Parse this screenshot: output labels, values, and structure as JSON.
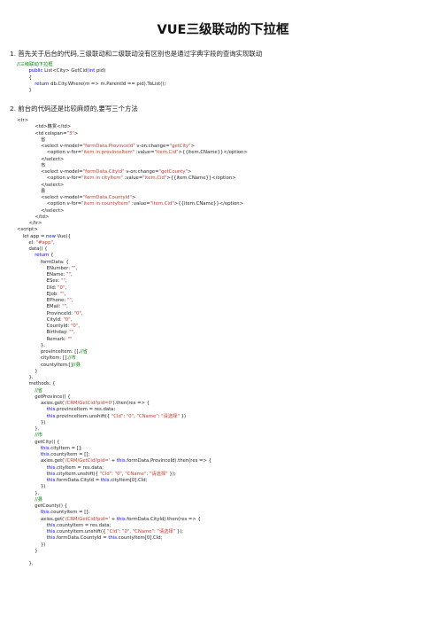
{
  "title": "VUE三级联动的下拉框",
  "section1": {
    "heading": "1. 首先关于后台的代码,三级联动和二级联动没有区别也是通过字典字段的查询实现联动",
    "code": [
      [
        {
          "t": "//三级联动下拉框",
          "c": "cm"
        }
      ],
      [
        {
          "t": "        "
        },
        {
          "t": "public",
          "c": "kw"
        },
        {
          "t": " List<City> GetCid("
        },
        {
          "t": "int",
          "c": "kw"
        },
        {
          "t": " pid)"
        }
      ],
      [
        {
          "t": "        {"
        }
      ],
      [
        {
          "t": "            "
        },
        {
          "t": "return",
          "c": "kw"
        },
        {
          "t": " db.City.Where(m => m.ParentId == pid).ToList();"
        }
      ],
      [
        {
          "t": "        }"
        }
      ]
    ]
  },
  "section2": {
    "heading": "2. 前台的代码还是比较麻烦的,要写三个方法",
    "code": [
      [
        {
          "t": "<tr>"
        }
      ],
      [
        {
          "t": "            <td>籍贯</td>"
        }
      ],
      [
        {
          "t": "            <td colspan="
        },
        {
          "t": "\"3\"",
          "c": "str"
        },
        {
          "t": ">"
        }
      ],
      [
        {
          "t": "                省"
        }
      ],
      [
        {
          "t": "                <select v-model="
        },
        {
          "t": "\"formData.ProvinceId\"",
          "c": "str"
        },
        {
          "t": " v-on:change="
        },
        {
          "t": "\"getCity\"",
          "c": "str"
        },
        {
          "t": ">"
        }
      ],
      [
        {
          "t": "                    <option v-for="
        },
        {
          "t": "\"item in provinceItem\"",
          "c": "str"
        },
        {
          "t": " :value="
        },
        {
          "t": "\"item.Cid\"",
          "c": "str"
        },
        {
          "t": ">{{item.CName}}</option>"
        }
      ],
      [
        {
          "t": "                </select>"
        }
      ],
      [
        {
          "t": "                市"
        }
      ],
      [
        {
          "t": "                <select v-model="
        },
        {
          "t": "\"formData.CityId\"",
          "c": "str"
        },
        {
          "t": " v-on:change="
        },
        {
          "t": "\"getCounty\"",
          "c": "str"
        },
        {
          "t": ">"
        }
      ],
      [
        {
          "t": "                    <option v-for="
        },
        {
          "t": "\"item in cityItem\"",
          "c": "str"
        },
        {
          "t": " :value="
        },
        {
          "t": "\"item.Cid\"",
          "c": "str"
        },
        {
          "t": ">{{item.CName}}</option>"
        }
      ],
      [
        {
          "t": "                </select>"
        }
      ],
      [
        {
          "t": "                县"
        }
      ],
      [
        {
          "t": "                <select v-model="
        },
        {
          "t": "\"formData.CountyId\"",
          "c": "str"
        },
        {
          "t": ">"
        }
      ],
      [
        {
          "t": "                    <option v-for="
        },
        {
          "t": "\"item in countyItem\"",
          "c": "str"
        },
        {
          "t": " :value="
        },
        {
          "t": "\"item.Cid\"",
          "c": "str"
        },
        {
          "t": ">{{item.CName}}</option>"
        }
      ],
      [
        {
          "t": "                </select>"
        }
      ],
      [
        {
          "t": "            </td>"
        }
      ],
      [
        {
          "t": "        </tr>"
        }
      ],
      [
        {
          "t": "<script>"
        }
      ],
      [
        {
          "t": "    let app = "
        },
        {
          "t": "new",
          "c": "kw"
        },
        {
          "t": " Vue({"
        }
      ],
      [
        {
          "t": "        el: "
        },
        {
          "t": "\"#app\"",
          "c": "str"
        },
        {
          "t": ","
        }
      ],
      [
        {
          "t": "        data() {"
        }
      ],
      [
        {
          "t": "            "
        },
        {
          "t": "return",
          "c": "kw"
        },
        {
          "t": " {"
        }
      ],
      [
        {
          "t": "                formData: {"
        }
      ],
      [
        {
          "t": "                    ENumber: "
        },
        {
          "t": "\"\"",
          "c": "str"
        },
        {
          "t": ","
        }
      ],
      [
        {
          "t": "                    EName: "
        },
        {
          "t": "\"\"",
          "c": "str"
        },
        {
          "t": ","
        }
      ],
      [
        {
          "t": "                    ESex: "
        },
        {
          "t": "\"\"",
          "c": "str"
        },
        {
          "t": ","
        }
      ],
      [
        {
          "t": "                    DId: "
        },
        {
          "t": "\"0\"",
          "c": "str"
        },
        {
          "t": ","
        }
      ],
      [
        {
          "t": "                    EJob: "
        },
        {
          "t": "\"\"",
          "c": "str"
        },
        {
          "t": ","
        }
      ],
      [
        {
          "t": "                    EPhone: "
        },
        {
          "t": "\"\"",
          "c": "str"
        },
        {
          "t": ","
        }
      ],
      [
        {
          "t": "                    EMail: "
        },
        {
          "t": "\"\"",
          "c": "str"
        },
        {
          "t": ","
        }
      ],
      [
        {
          "t": "                    ProvinceId: "
        },
        {
          "t": "\"0\"",
          "c": "str"
        },
        {
          "t": ","
        }
      ],
      [
        {
          "t": "                    CityId: "
        },
        {
          "t": "\"0\"",
          "c": "str"
        },
        {
          "t": ","
        }
      ],
      [
        {
          "t": "                    CountyId: "
        },
        {
          "t": "\"0\"",
          "c": "str"
        },
        {
          "t": ","
        }
      ],
      [
        {
          "t": "                    Birthday: "
        },
        {
          "t": "\"\"",
          "c": "str"
        },
        {
          "t": ","
        }
      ],
      [
        {
          "t": "                    Remark: "
        },
        {
          "t": "\"\"",
          "c": "str"
        }
      ],
      [
        {
          "t": "                },"
        }
      ],
      [
        {
          "t": "                provinceItem: [],"
        },
        {
          "t": "//省",
          "c": "cm"
        }
      ],
      [
        {
          "t": "                cityItem: [],"
        },
        {
          "t": "//市",
          "c": "cm"
        }
      ],
      [
        {
          "t": "                countyItem:[]"
        },
        {
          "t": "//县",
          "c": "cm"
        }
      ],
      [
        {
          "t": "            }"
        }
      ],
      [
        {
          "t": "        },"
        }
      ],
      [
        {
          "t": "        methods: {"
        }
      ],
      [
        {
          "t": "            "
        },
        {
          "t": "//省",
          "c": "cm"
        }
      ],
      [
        {
          "t": "            getProvince() {"
        }
      ],
      [
        {
          "t": "                axios.get("
        },
        {
          "t": "'/CRM/GetCid?pid=0'",
          "c": "str"
        },
        {
          "t": ").then(res => {"
        }
      ],
      [
        {
          "t": "                    "
        },
        {
          "t": "this",
          "c": "kw"
        },
        {
          "t": ".provinceItem = res.data;"
        }
      ],
      [
        {
          "t": "                    "
        },
        {
          "t": "this",
          "c": "kw"
        },
        {
          "t": ".provinceItem.unshift({ "
        },
        {
          "t": "\"CId\"",
          "c": "str"
        },
        {
          "t": ": "
        },
        {
          "t": "\"0\"",
          "c": "str"
        },
        {
          "t": ", "
        },
        {
          "t": "\"CName\"",
          "c": "str"
        },
        {
          "t": ": "
        },
        {
          "t": "\"请选择\"",
          "c": "str"
        },
        {
          "t": " })"
        }
      ],
      [
        {
          "t": "                })"
        }
      ],
      [
        {
          "t": "            },"
        }
      ],
      [
        {
          "t": "            "
        },
        {
          "t": "//市",
          "c": "cm"
        }
      ],
      [
        {
          "t": "            getCity() {"
        }
      ],
      [
        {
          "t": "                "
        },
        {
          "t": "this",
          "c": "kw"
        },
        {
          "t": ".cityItem = [];"
        }
      ],
      [
        {
          "t": "                "
        },
        {
          "t": "this",
          "c": "kw"
        },
        {
          "t": ".countyItem = [];"
        }
      ],
      [
        {
          "t": "                axios.get("
        },
        {
          "t": "'/CRM/GetCid?pid='",
          "c": "str"
        },
        {
          "t": " + "
        },
        {
          "t": "this",
          "c": "kw"
        },
        {
          "t": ".formData.ProvinceId).then(res => {"
        }
      ],
      [
        {
          "t": "                    "
        },
        {
          "t": "this",
          "c": "kw"
        },
        {
          "t": ".cityItem = res.data;"
        }
      ],
      [
        {
          "t": "                    "
        },
        {
          "t": "this",
          "c": "kw"
        },
        {
          "t": ".cityItem.unshift({ "
        },
        {
          "t": "\"CId\"",
          "c": "str"
        },
        {
          "t": ": "
        },
        {
          "t": "\"0\"",
          "c": "str"
        },
        {
          "t": ", "
        },
        {
          "t": "\"CName\"",
          "c": "str"
        },
        {
          "t": ": "
        },
        {
          "t": "\"请选择\"",
          "c": "str"
        },
        {
          "t": " });"
        }
      ],
      [
        {
          "t": "                    "
        },
        {
          "t": "this",
          "c": "kw"
        },
        {
          "t": ".formData.CityId = "
        },
        {
          "t": "this",
          "c": "kw"
        },
        {
          "t": ".cityItem[0].CId;"
        }
      ],
      [
        {
          "t": "                })"
        }
      ],
      [
        {
          "t": "            },"
        }
      ],
      [
        {
          "t": "            "
        },
        {
          "t": "//县",
          "c": "cm"
        }
      ],
      [
        {
          "t": "            getCounty() {"
        }
      ],
      [
        {
          "t": "                "
        },
        {
          "t": "this",
          "c": "kw"
        },
        {
          "t": ".countyItem = [];"
        }
      ],
      [
        {
          "t": "                axios.get("
        },
        {
          "t": "'/CRM/GetCid?pid='",
          "c": "str"
        },
        {
          "t": " + "
        },
        {
          "t": "this",
          "c": "kw"
        },
        {
          "t": ".formData.CityId).then(res => {"
        }
      ],
      [
        {
          "t": "                    "
        },
        {
          "t": "this",
          "c": "kw"
        },
        {
          "t": ".countyItem = res.data;"
        }
      ],
      [
        {
          "t": "                    "
        },
        {
          "t": "this",
          "c": "kw"
        },
        {
          "t": ".countyItem.unshift({ "
        },
        {
          "t": "\"CId\"",
          "c": "str"
        },
        {
          "t": ": "
        },
        {
          "t": "\"0\"",
          "c": "str"
        },
        {
          "t": ", "
        },
        {
          "t": "\"CName\"",
          "c": "str"
        },
        {
          "t": ": "
        },
        {
          "t": "\"请选择\"",
          "c": "str"
        },
        {
          "t": " });"
        }
      ],
      [
        {
          "t": "                    "
        },
        {
          "t": "this",
          "c": "kw"
        },
        {
          "t": ".formData.CountyId = "
        },
        {
          "t": "this",
          "c": "kw"
        },
        {
          "t": ".countyItem[0].CId;"
        }
      ],
      [
        {
          "t": "                })"
        }
      ],
      [
        {
          "t": "            }"
        }
      ],
      [
        {
          "t": ""
        }
      ],
      [
        {
          "t": "        },"
        }
      ]
    ]
  },
  "colors": {
    "comment": "#008000",
    "keyword": "#0000ff",
    "string": "#c0392b"
  }
}
